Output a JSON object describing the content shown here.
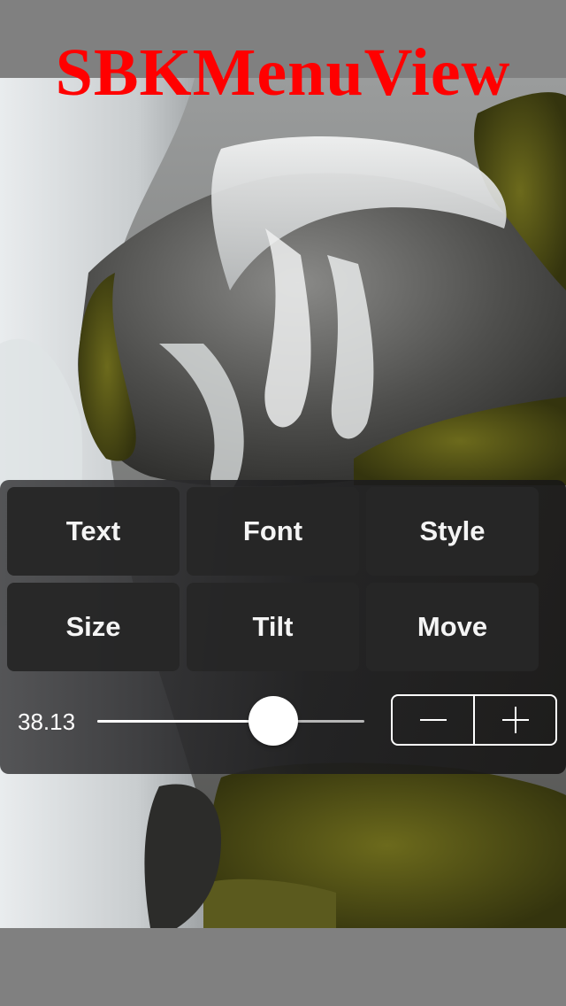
{
  "watermark": {
    "text": "SBKMenuView",
    "color": "#ff0000"
  },
  "photo": {
    "subject": "waterfall over mossy rocks"
  },
  "menu": {
    "buttons": [
      {
        "label": "Text"
      },
      {
        "label": "Font"
      },
      {
        "label": "Style"
      },
      {
        "label": "Size"
      },
      {
        "label": "Tilt"
      },
      {
        "label": "Move"
      }
    ],
    "slider": {
      "value_text": "38.13",
      "fraction": 0.66
    },
    "stepper": {
      "decrement_icon": "minus-icon",
      "increment_icon": "plus-icon"
    }
  }
}
